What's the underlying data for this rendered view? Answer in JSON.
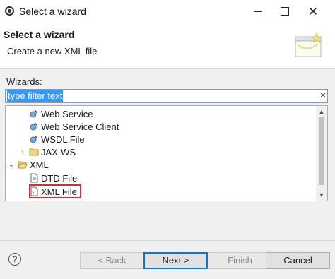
{
  "window": {
    "title": "Select a wizard"
  },
  "header": {
    "title": "Select a wizard",
    "subtitle": "Create a new XML file"
  },
  "wizards": {
    "label": "Wizards:",
    "filter_placeholder": "type filter text",
    "tree": [
      {
        "label": "Web Service",
        "icon": "web-service-icon"
      },
      {
        "label": "Web Service Client",
        "icon": "web-service-client-icon"
      },
      {
        "label": "WSDL File",
        "icon": "wsdl-file-icon"
      },
      {
        "label": "JAX-WS",
        "icon": "folder-icon",
        "collapsed": true
      },
      {
        "label": "XML",
        "icon": "folder-open-icon",
        "expanded": true
      },
      {
        "label": "DTD File",
        "icon": "dtd-file-icon"
      },
      {
        "label": "XML File",
        "icon": "xml-file-icon",
        "selected": true
      }
    ]
  },
  "buttons": {
    "help": "?",
    "back": "< Back",
    "next": "Next >",
    "finish": "Finish",
    "cancel": "Cancel"
  },
  "colors": {
    "highlight": "#e0282d",
    "selection": "#3399ff",
    "default_button_border": "#0078d7"
  }
}
